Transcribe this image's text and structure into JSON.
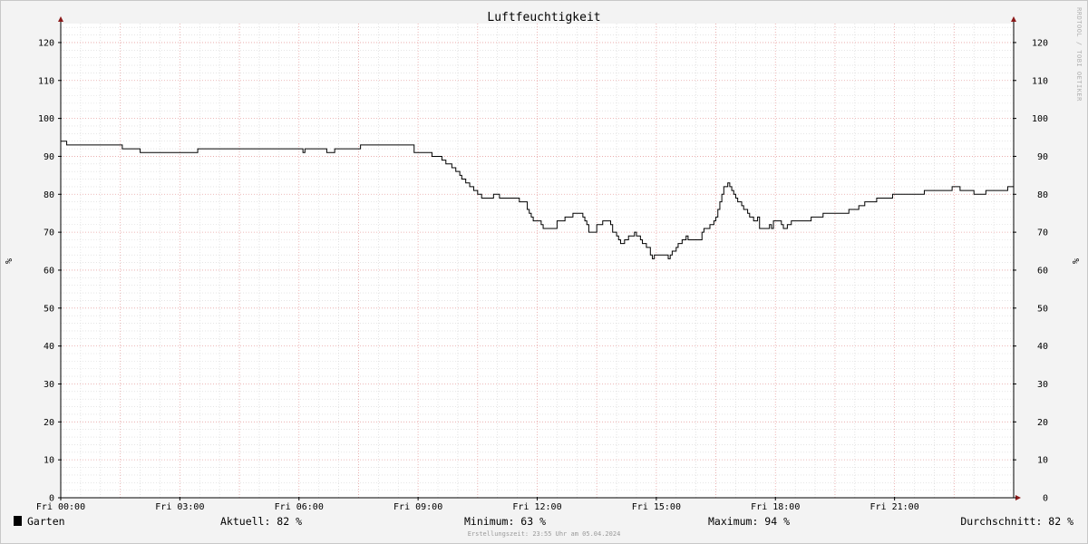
{
  "chart_data": {
    "type": "line",
    "title": "Luftfeuchtigkeit",
    "ylabel": "%",
    "watermark": "RRDTOOL / TOBI OETIKER",
    "ylim": [
      0,
      125
    ],
    "yticks": [
      0,
      10,
      20,
      30,
      40,
      50,
      60,
      70,
      80,
      90,
      100,
      110,
      120
    ],
    "xlim_hours": [
      0,
      24
    ],
    "xticks": [
      {
        "hour": 0,
        "label": "Fri 00:00"
      },
      {
        "hour": 3,
        "label": "Fri 03:00"
      },
      {
        "hour": 6,
        "label": "Fri 06:00"
      },
      {
        "hour": 9,
        "label": "Fri 09:00"
      },
      {
        "hour": 12,
        "label": "Fri 12:00"
      },
      {
        "hour": 15,
        "label": "Fri 15:00"
      },
      {
        "hour": 18,
        "label": "Fri 18:00"
      },
      {
        "hour": 21,
        "label": "Fri 21:00"
      }
    ],
    "grid": true,
    "series": [
      {
        "name": "Garten",
        "color": "#000000",
        "points": [
          [
            0.0,
            94
          ],
          [
            0.15,
            93
          ],
          [
            1.5,
            93
          ],
          [
            1.55,
            92
          ],
          [
            1.95,
            92
          ],
          [
            2.0,
            91
          ],
          [
            3.4,
            91
          ],
          [
            3.45,
            92
          ],
          [
            6.05,
            92
          ],
          [
            6.1,
            91
          ],
          [
            6.15,
            92
          ],
          [
            6.65,
            92
          ],
          [
            6.7,
            91
          ],
          [
            6.85,
            91
          ],
          [
            6.9,
            92
          ],
          [
            7.5,
            92
          ],
          [
            7.55,
            93
          ],
          [
            8.8,
            93
          ],
          [
            8.9,
            91
          ],
          [
            9.3,
            91
          ],
          [
            9.35,
            90
          ],
          [
            9.55,
            90
          ],
          [
            9.6,
            89
          ],
          [
            9.7,
            88
          ],
          [
            9.85,
            87
          ],
          [
            9.95,
            86
          ],
          [
            10.05,
            85
          ],
          [
            10.1,
            84
          ],
          [
            10.2,
            83
          ],
          [
            10.3,
            82
          ],
          [
            10.4,
            81
          ],
          [
            10.5,
            80
          ],
          [
            10.6,
            79
          ],
          [
            10.85,
            79
          ],
          [
            10.9,
            80
          ],
          [
            11.0,
            80
          ],
          [
            11.05,
            79
          ],
          [
            11.5,
            79
          ],
          [
            11.55,
            78
          ],
          [
            11.7,
            78
          ],
          [
            11.75,
            76
          ],
          [
            11.8,
            75
          ],
          [
            11.85,
            74
          ],
          [
            11.9,
            73
          ],
          [
            12.05,
            73
          ],
          [
            12.1,
            72
          ],
          [
            12.15,
            71
          ],
          [
            12.45,
            71
          ],
          [
            12.5,
            73
          ],
          [
            12.65,
            73
          ],
          [
            12.7,
            74
          ],
          [
            12.85,
            74
          ],
          [
            12.9,
            75
          ],
          [
            13.1,
            75
          ],
          [
            13.15,
            74
          ],
          [
            13.2,
            73
          ],
          [
            13.25,
            72
          ],
          [
            13.3,
            70
          ],
          [
            13.45,
            70
          ],
          [
            13.5,
            72
          ],
          [
            13.6,
            72
          ],
          [
            13.65,
            73
          ],
          [
            13.8,
            73
          ],
          [
            13.85,
            72
          ],
          [
            13.9,
            70
          ],
          [
            14.0,
            69
          ],
          [
            14.05,
            68
          ],
          [
            14.1,
            67
          ],
          [
            14.2,
            68
          ],
          [
            14.3,
            69
          ],
          [
            14.45,
            70
          ],
          [
            14.5,
            69
          ],
          [
            14.6,
            68
          ],
          [
            14.65,
            67
          ],
          [
            14.75,
            66
          ],
          [
            14.85,
            64
          ],
          [
            14.9,
            63
          ],
          [
            14.95,
            64
          ],
          [
            15.25,
            64
          ],
          [
            15.3,
            63
          ],
          [
            15.35,
            64
          ],
          [
            15.4,
            65
          ],
          [
            15.5,
            66
          ],
          [
            15.55,
            67
          ],
          [
            15.65,
            68
          ],
          [
            15.75,
            69
          ],
          [
            15.8,
            68
          ],
          [
            16.1,
            68
          ],
          [
            16.15,
            70
          ],
          [
            16.2,
            71
          ],
          [
            16.35,
            72
          ],
          [
            16.45,
            73
          ],
          [
            16.5,
            74
          ],
          [
            16.55,
            76
          ],
          [
            16.6,
            78
          ],
          [
            16.65,
            80
          ],
          [
            16.7,
            82
          ],
          [
            16.8,
            83
          ],
          [
            16.85,
            82
          ],
          [
            16.9,
            81
          ],
          [
            16.95,
            80
          ],
          [
            17.0,
            79
          ],
          [
            17.05,
            78
          ],
          [
            17.15,
            77
          ],
          [
            17.2,
            76
          ],
          [
            17.3,
            75
          ],
          [
            17.35,
            74
          ],
          [
            17.45,
            73
          ],
          [
            17.55,
            74
          ],
          [
            17.6,
            71
          ],
          [
            17.8,
            71
          ],
          [
            17.85,
            72
          ],
          [
            17.9,
            71
          ],
          [
            17.95,
            73
          ],
          [
            18.1,
            73
          ],
          [
            18.15,
            72
          ],
          [
            18.2,
            71
          ],
          [
            18.3,
            72
          ],
          [
            18.4,
            73
          ],
          [
            18.85,
            73
          ],
          [
            18.9,
            74
          ],
          [
            19.15,
            74
          ],
          [
            19.2,
            75
          ],
          [
            19.8,
            75
          ],
          [
            19.85,
            76
          ],
          [
            20.05,
            76
          ],
          [
            20.1,
            77
          ],
          [
            20.2,
            77
          ],
          [
            20.25,
            78
          ],
          [
            20.5,
            78
          ],
          [
            20.55,
            79
          ],
          [
            20.9,
            79
          ],
          [
            20.95,
            80
          ],
          [
            21.7,
            80
          ],
          [
            21.75,
            81
          ],
          [
            22.4,
            81
          ],
          [
            22.45,
            82
          ],
          [
            22.6,
            82
          ],
          [
            22.65,
            81
          ],
          [
            22.95,
            81
          ],
          [
            23.0,
            80
          ],
          [
            23.25,
            80
          ],
          [
            23.3,
            81
          ],
          [
            23.8,
            81
          ],
          [
            23.85,
            82
          ],
          [
            24.0,
            82
          ]
        ]
      }
    ]
  },
  "legend": {
    "series_name": "Garten",
    "swatch_color": "#000000",
    "aktuell": "Aktuell:  82 %",
    "minimum": "Minimum:  63 %",
    "maximum": "Maximum:  94 %",
    "durchschnitt": "Durchschnitt:  82 %"
  },
  "footer": "Erstellungszeit: 23:55 Uhr am 05.04.2024",
  "colors": {
    "major_grid": "#e7a3a3",
    "minor_grid": "#d6d6d6",
    "axis": "#000000",
    "arrow": "#8b1a1a",
    "plot_bg": "#ffffff"
  }
}
